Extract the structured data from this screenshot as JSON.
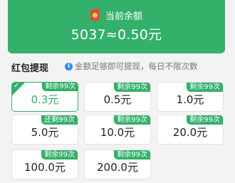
{
  "balance": {
    "label": "当前余额",
    "value": "5037≈0.50元"
  },
  "section": {
    "title": "红包提现",
    "notice": "金额足够即可提现，每日不限次数",
    "notice_icon": "i"
  },
  "options": [
    {
      "amount": "0.3元",
      "badge": "剩余99次",
      "selected": true
    },
    {
      "amount": "0.5元",
      "badge": "剩余99次"
    },
    {
      "amount": "1.0元",
      "badge": "剩余99次"
    },
    {
      "amount": "5.0元",
      "badge": "还剩99次"
    },
    {
      "amount": "10.0元",
      "badge": "剩余99次"
    },
    {
      "amount": "20.0元",
      "badge": "剩余99次"
    },
    {
      "amount": "100.0元",
      "badge": "剩余99次"
    },
    {
      "amount": "200.0元",
      "badge": "剩余99次"
    }
  ],
  "colors": {
    "accent": "#33b06a",
    "info": "#2d8cf0",
    "red_packet": "#e64a3b"
  }
}
